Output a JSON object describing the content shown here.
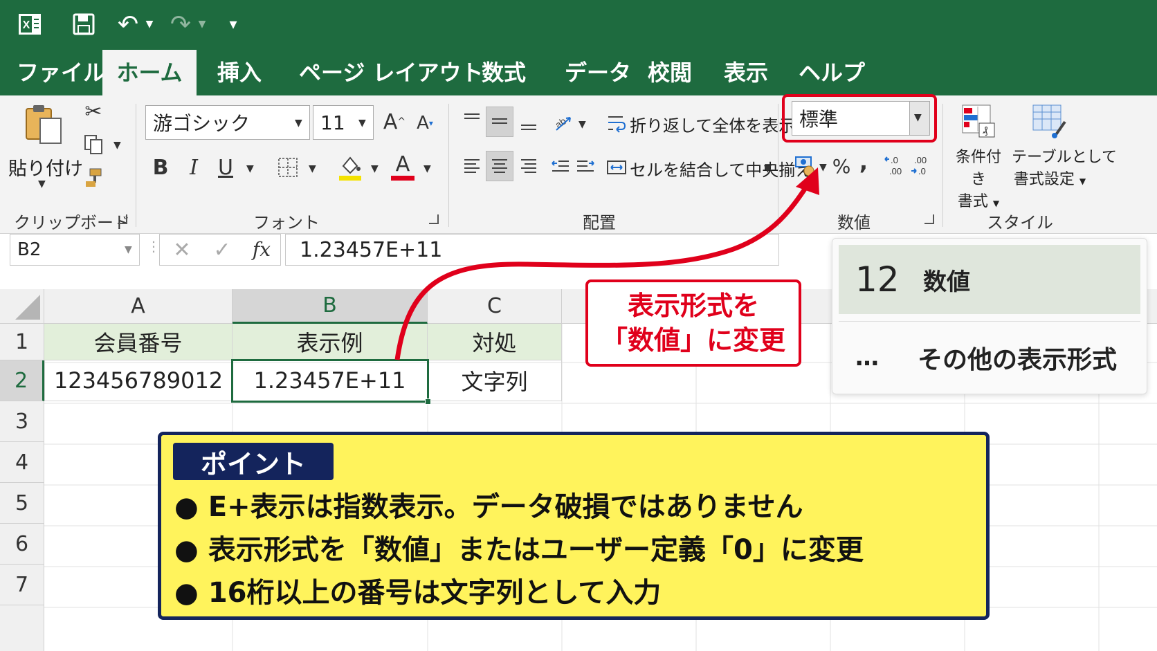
{
  "quick_access": {
    "undo_label": "↶",
    "redo_label": "↷",
    "customize_label": "▾"
  },
  "tabs": [
    {
      "label": "ファイル"
    },
    {
      "label": "ホーム"
    },
    {
      "label": "挿入"
    },
    {
      "label": "ページ レイアウト"
    },
    {
      "label": "数式"
    },
    {
      "label": "データ"
    },
    {
      "label": "校閲"
    },
    {
      "label": "表示"
    },
    {
      "label": "ヘルプ"
    }
  ],
  "ribbon": {
    "clipboard": {
      "paste_label": "貼り付け",
      "group_label": "クリップボード"
    },
    "font": {
      "font_name": "游ゴシック",
      "font_size": "11",
      "group_label": "フォント",
      "bold": "B",
      "italic": "I",
      "underline": "U",
      "font_color_glyph": "A"
    },
    "alignment": {
      "wrap_text": "折り返して全体を表示する",
      "merge_center": "セルを結合して中央揃え",
      "group_label": "配置"
    },
    "number": {
      "format_value": "標準",
      "percent": "%",
      "comma": ",",
      "group_label": "数値"
    },
    "styles": {
      "conditional_format": [
        "条件付き",
        "書式"
      ],
      "format_as_table": [
        "テーブルとして",
        "書式設定"
      ],
      "group_label": "スタイル"
    }
  },
  "formula_bar": {
    "name_box": "B2",
    "fx": "fx",
    "value": "1.23457E+11"
  },
  "columns": [
    "A",
    "B",
    "C"
  ],
  "rows": [
    "1",
    "2",
    "3",
    "4",
    "5",
    "6",
    "7"
  ],
  "cells": {
    "A1": "会員番号",
    "B1": "表示例",
    "C1": "対処",
    "A2": "123456789012",
    "B2": "1.23457E+11",
    "C2": "文字列"
  },
  "format_dropdown": {
    "numeric_icon": "12",
    "numeric_label": "数値",
    "more_icon": "…",
    "more_label": "その他の表示形式"
  },
  "callout": {
    "line1": "表示形式を",
    "line2": "「数値」に変更"
  },
  "point_box": {
    "title": "ポイント",
    "bullets": [
      "E+表示は指数表示。データ破損ではありません",
      "表示形式を「数値」またはユーザー定義「0」に変更",
      "16桁以上の番号は文字列として入力"
    ]
  },
  "colors": {
    "excel_green": "#1e6b3f",
    "highlight_red": "#e0001b",
    "point_yellow": "#fff35c",
    "point_navy": "#14245c"
  }
}
